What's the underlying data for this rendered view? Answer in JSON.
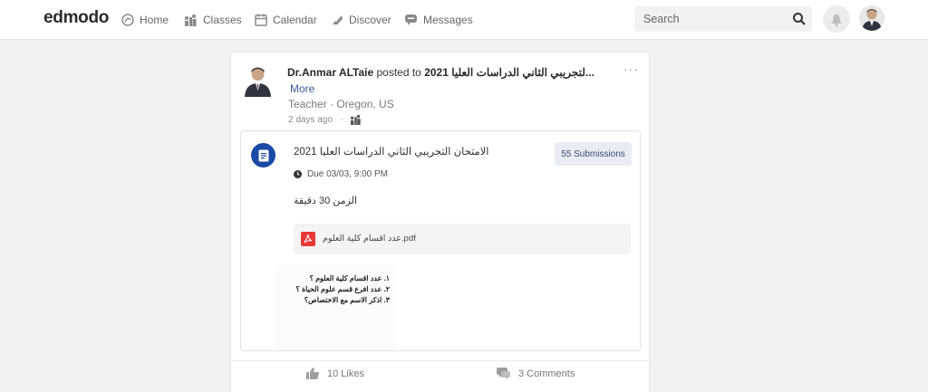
{
  "app": {
    "logo_text": "edmodo"
  },
  "nav": {
    "items": [
      {
        "label": "Home",
        "icon": "home-icon"
      },
      {
        "label": "Classes",
        "icon": "classes-icon"
      },
      {
        "label": "Calendar",
        "icon": "calendar-icon"
      },
      {
        "label": "Discover",
        "icon": "discover-icon"
      },
      {
        "label": "Messages",
        "icon": "messages-icon"
      }
    ],
    "search_placeholder": "Search"
  },
  "post": {
    "author": "Dr.Anmar ALTaie",
    "posted_to_prefix": " posted to ",
    "group_name": "2021 لتجريبي الثاني الدراسات العليا...",
    "more_label": "More",
    "author_meta": "Teacher · Oregon, US",
    "time_ago": "2 days ago",
    "menu_label": "···",
    "assignment": {
      "title": "الامتحان التجريبي الثاني الدراسات العليا 2021",
      "due": "Due 03/03, 9:00 PM",
      "submissions_label": "55 Submissions",
      "instructions": "الزمن 30 دقيقة",
      "attachment_name": "عدد اقسام كلية العلوم.pdf",
      "preview_lines": [
        "١. عدد اقسام كلية العلوم ؟",
        "٢. عدد افرع قسم علوم الحياة ؟",
        "٣. اذكر الاسم مع الاختصاص؟"
      ]
    },
    "likes_label": "10 Likes",
    "comments_label": "3 Comments"
  },
  "colors": {
    "accent_blue": "#1b49a6",
    "link_blue": "#3d5a96",
    "pdf_red": "#e53935"
  }
}
